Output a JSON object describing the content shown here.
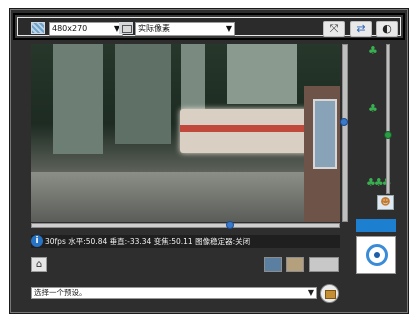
{
  "toolbar": {
    "resolution_value": "480x270",
    "pixel_mode_value": "实际像素",
    "icons": [
      "resolution-icon",
      "pixel-mode-icon",
      "fullscreen-icon",
      "swap-icon",
      "camera-settings-icon"
    ]
  },
  "status": {
    "text": "30fps 水平:50.84 垂直:-33.34 变焦:50.11 图像稳定器:关闭"
  },
  "controls": {
    "preset_placeholder": "选择一个预设。",
    "view_buttons": [
      "view-single",
      "view-screen",
      "view-split"
    ]
  },
  "sliders": {
    "pan_fraction": 0.64,
    "tilt_fraction": 0.43,
    "zoom_fraction": 0.6
  },
  "colors": {
    "accent": "#1c7fd0",
    "frame": "#2e2e2e"
  }
}
